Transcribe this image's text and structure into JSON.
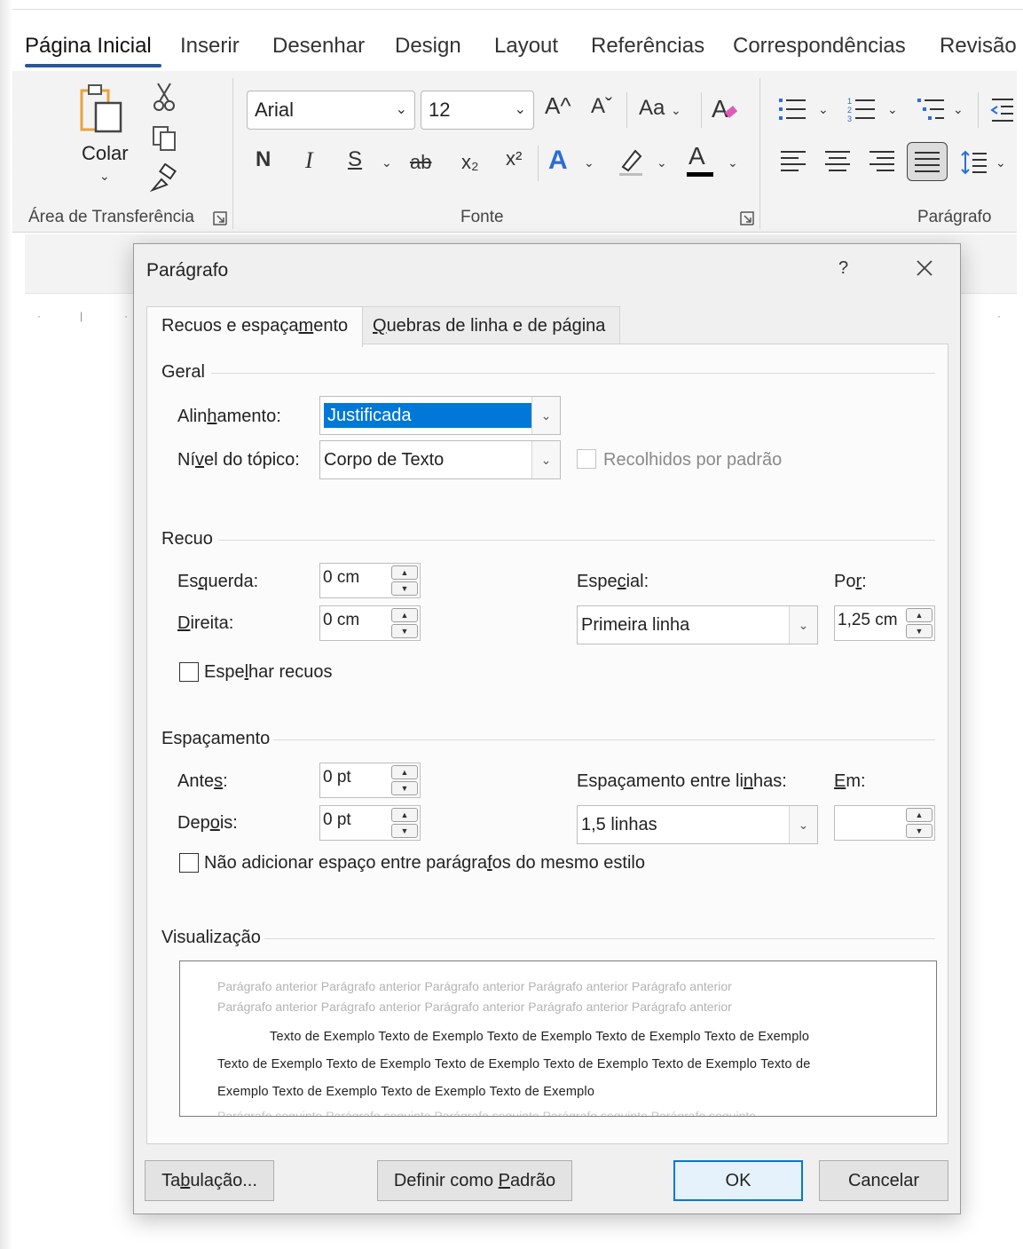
{
  "ribbon": {
    "tabs": [
      "Página Inicial",
      "Inserir",
      "Desenhar",
      "Design",
      "Layout",
      "Referências",
      "Correspondências",
      "Revisão"
    ],
    "clipboard": {
      "paste_label": "Colar",
      "group_label": "Área de Transferência"
    },
    "font": {
      "name": "Arial",
      "size": "12",
      "group_label": "Fonte",
      "bold_label": "N",
      "italic_label": "I",
      "underline_label": "S",
      "strike_label": "ab",
      "subscript_label": "x₂",
      "superscript_label": "x²",
      "change_case_label": "Aa",
      "text_effects_label": "A",
      "font_color_label": "A",
      "grow_label": "A^",
      "shrink_label": "Aˇ",
      "colors": {
        "font_color_bar": "#000000",
        "effects_blue": "#2b6ed2"
      }
    },
    "paragraph": {
      "group_label": "Parágrafo"
    }
  },
  "dialog": {
    "title": "Parágrafo",
    "help": "?",
    "tabs": {
      "indents_spacing": {
        "pre": "Recuos e espaça",
        "key": "m",
        "post": "ento"
      },
      "line_page_breaks": {
        "key": "Q",
        "post": "uebras de linha e de página"
      }
    },
    "general": {
      "title": "Geral",
      "alignment": {
        "pre": "Alin",
        "key": "h",
        "post": "amento:",
        "value": "Justificada"
      },
      "outline_level": {
        "pre": "Ní",
        "key": "v",
        "post": "el do tópico:",
        "value": "Corpo de Texto"
      },
      "collapsed_default": "Recolhidos por padrão"
    },
    "indent": {
      "title": "Recuo",
      "left": {
        "pre": "Es",
        "key": "q",
        "post": "uerda:",
        "value": "0 cm"
      },
      "right": {
        "pre": "",
        "key": "D",
        "post": "ireita:",
        "value": "0 cm"
      },
      "special": {
        "pre": "Espe",
        "key": "c",
        "post": "ial:",
        "value": "Primeira linha"
      },
      "by": {
        "pre": "Po",
        "key": "r",
        "post": ":",
        "value": "1,25 cm"
      },
      "mirror": {
        "pre": "Espe",
        "key": "l",
        "post": "har recuos"
      }
    },
    "spacing": {
      "title": "Espaçamento",
      "before": {
        "pre": "Ante",
        "key": "s",
        "post": ":",
        "value": "0 pt"
      },
      "after": {
        "pre": "Dep",
        "key": "o",
        "post": "is:",
        "value": "0 pt"
      },
      "line_spacing": {
        "pre": "Espaçamento entre li",
        "key": "n",
        "post": "has:",
        "value": "1,5 linhas"
      },
      "at": {
        "pre": "",
        "key": "E",
        "post": "m:",
        "value": ""
      },
      "dont_add": {
        "pre": "Não adicionar espaço entre parágra",
        "key": "f",
        "post": "os do mesmo estilo"
      }
    },
    "preview": {
      "title": "Visualização",
      "previous_lines": [
        "Parágrafo anterior Parágrafo anterior Parágrafo anterior Parágrafo anterior Parágrafo anterior",
        "Parágrafo anterior Parágrafo anterior Parágrafo anterior Parágrafo anterior Parágrafo anterior"
      ],
      "sample_lines": [
        "Texto de Exemplo Texto de Exemplo Texto de Exemplo Texto de Exemplo Texto de Exemplo",
        "Texto de Exemplo Texto de Exemplo Texto de Exemplo Texto de Exemplo Texto de Exemplo Texto de",
        "Exemplo Texto de Exemplo Texto de Exemplo Texto de Exemplo"
      ],
      "next_line": "Parágrafo seguinte Parágrafo seguinte Parágrafo seguinte Parágrafo seguinte Parágrafo seguinte"
    },
    "buttons": {
      "tabs": {
        "pre": "Ta",
        "key": "b",
        "post": "ulação..."
      },
      "set_default": {
        "pre": "Definir como ",
        "key": "P",
        "post": "adrão"
      },
      "ok": "OK",
      "cancel": "Cancelar"
    },
    "colors": {
      "selection": "#0078d7",
      "accent_border": "#0078d7"
    }
  }
}
